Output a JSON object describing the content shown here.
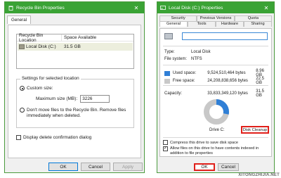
{
  "recycle_bin_window": {
    "title": "Recycle Bin Properties",
    "tab": "General",
    "list": {
      "headers": [
        "Recycle Bin Location",
        "Space Available"
      ],
      "rows": [
        {
          "location": "Local Disk (C:)",
          "space": "31.5 GB"
        }
      ]
    },
    "settings_group_label": "Settings for selected location",
    "custom_size_label": "Custom size:",
    "max_size_label": "Maximum size (MB):",
    "max_size_value": "3226",
    "dont_move_label": "Don't move files to the Recycle Bin. Remove files immediately when deleted.",
    "confirm_dialog_label": "Display delete confirmation dialog",
    "buttons": {
      "ok": "OK",
      "cancel": "Cancel",
      "apply": "Apply"
    }
  },
  "disk_window": {
    "title": "Local Disk (C:) Properties",
    "tabs_top": [
      "Security",
      "Previous Versions",
      "Quota"
    ],
    "tabs_bottom": [
      "General",
      "Tools",
      "Hardware",
      "Sharing"
    ],
    "type_label": "Type:",
    "type_value": "Local Disk",
    "fs_label": "File system:",
    "fs_value": "NTFS",
    "used_label": "Used space:",
    "used_bytes": "9,524,510,464 bytes",
    "used_gb": "8.96 GB",
    "free_label": "Free space:",
    "free_bytes": "24,208,838,656 bytes",
    "free_gb": "22.5 GB",
    "capacity_label": "Capacity:",
    "capacity_bytes": "33,833,349,120 bytes",
    "capacity_gb": "31.5 GB",
    "drive_label": "Drive C:",
    "disk_cleanup_label": "Disk Cleanup",
    "compress_label": "Compress this drive to save disk space",
    "index_label": "Allow files on this drive to have contents indexed in addition to file properties",
    "buttons": {
      "ok": "OK",
      "cancel": "Cancel"
    },
    "used_fraction": 0.283
  },
  "watermark": "XITONGZHIJIA.NET",
  "colors": {
    "titlebar": "#3aa335",
    "used": "#2f7fd6",
    "free": "#c8c8c8",
    "highlight": "#e0201a"
  }
}
